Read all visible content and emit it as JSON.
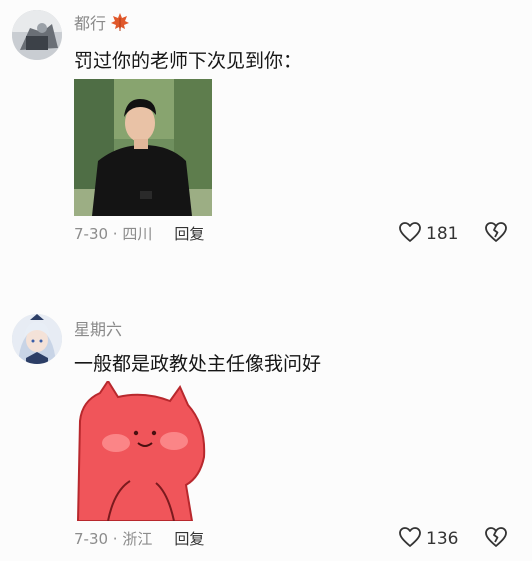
{
  "comments": [
    {
      "username": "都行",
      "badge_icon": "maple-leaf-icon",
      "text": "罚过你的老师下次见到你：",
      "date_location": "7-30 · 四川",
      "reply_label": "回复",
      "like_count": "181",
      "like_icon": "heart-outline-icon",
      "dislike_icon": "broken-heart-icon"
    },
    {
      "username": "星期六",
      "text": "一般都是政教处主任像我问好",
      "date_location": "7-30 · 浙江",
      "reply_label": "回复",
      "like_count": "136",
      "like_icon": "heart-outline-icon",
      "dislike_icon": "broken-heart-icon"
    }
  ],
  "colors": {
    "background": "#fcfcfc",
    "username": "#8a8a8a",
    "meta": "#8c8c8c",
    "text": "#161616"
  }
}
